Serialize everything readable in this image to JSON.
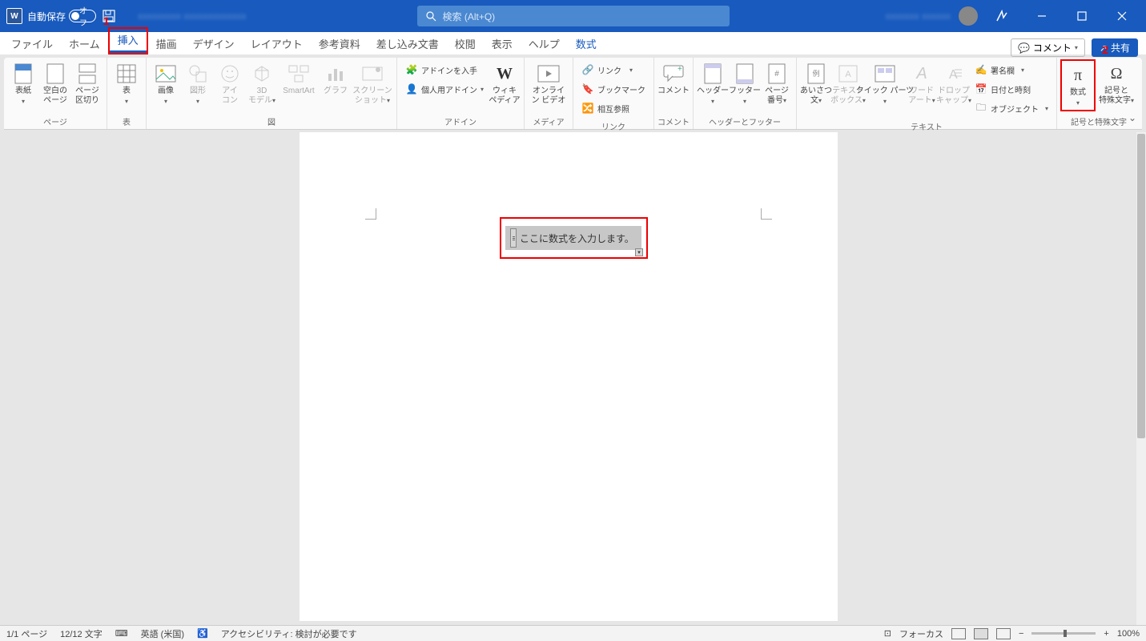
{
  "titleBar": {
    "autoSaveLabel": "自動保存",
    "autoSaveState": "オフ",
    "searchPlaceholder": "検索 (Alt+Q)"
  },
  "callouts": {
    "1": "1",
    "2": "2"
  },
  "tabs": {
    "file": "ファイル",
    "home": "ホーム",
    "insert": "挿入",
    "draw": "描画",
    "design": "デザイン",
    "layout": "レイアウト",
    "references": "参考資料",
    "mailings": "差し込み文書",
    "review": "校閲",
    "view": "表示",
    "help": "ヘルプ",
    "equation": "数式"
  },
  "headerRight": {
    "comments": "コメント",
    "share": "共有"
  },
  "ribbon": {
    "pages": {
      "label": "ページ",
      "cover": "表紙",
      "blank1": "空白の",
      "blank2": "ページ",
      "break1": "ページ",
      "break2": "区切り"
    },
    "tables": {
      "label": "表",
      "table": "表"
    },
    "illustrations": {
      "label": "図",
      "pictures": "画像",
      "shapes": "図形",
      "icon1": "アイ",
      "icon2": "コン",
      "models1": "3D",
      "models2": "モデル",
      "smartart": "SmartArt",
      "chart": "グラフ",
      "screen1": "スクリーン",
      "screen2": "ショット"
    },
    "addins": {
      "label": "アドイン",
      "get": "アドインを入手",
      "personal": "個人用アドイン",
      "wiki1": "ウィキ",
      "wiki2": "ペディア"
    },
    "media": {
      "label": "メディア",
      "onlinevideo1": "オンライ",
      "onlinevideo2": "ン ビデオ"
    },
    "links": {
      "label": "リンク",
      "link": "リンク",
      "bookmark": "ブックマーク",
      "crossref": "相互参照"
    },
    "comments": {
      "label": "コメント",
      "comment": "コメント"
    },
    "hf": {
      "label": "ヘッダーとフッター",
      "header": "ヘッダー",
      "footer": "フッター",
      "pagenum1": "ページ",
      "pagenum2": "番号"
    },
    "text": {
      "label": "テキスト",
      "greeting1": "あいさつ",
      "greeting2": "文",
      "textbox1": "テキスト",
      "textbox2": "ボックス",
      "quickparts": "クイック パーツ",
      "wordart1": "ワード",
      "wordart2": "アート",
      "dropcap1": "ドロップ",
      "dropcap2": "キャップ",
      "signature": "署名欄",
      "datetime": "日付と時刻",
      "object": "オブジェクト"
    },
    "symbols": {
      "label": "記号と特殊文字",
      "equation": "数式",
      "symbol1": "記号と",
      "symbol2": "特殊文字"
    }
  },
  "document": {
    "equationPlaceholder": "ここに数式を入力します。"
  },
  "statusBar": {
    "page": "1/1 ページ",
    "words": "12/12 文字",
    "lang": "英語 (米国)",
    "accessibility": "アクセシビリティ: 検討が必要です",
    "focus": "フォーカス",
    "zoom": "100%"
  }
}
